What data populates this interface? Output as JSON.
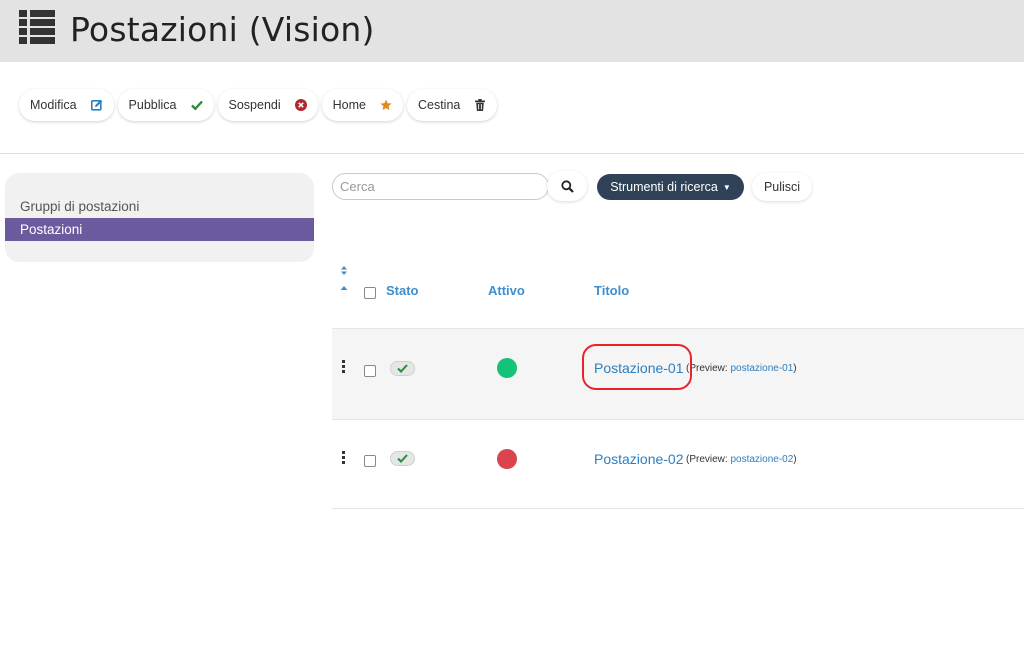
{
  "header": {
    "title": "Postazioni (Vision)",
    "icon": "list-icon"
  },
  "toolbar": {
    "buttons": [
      {
        "label": "Modifica",
        "icon": "edit-icon",
        "color": "#2a7fc1"
      },
      {
        "label": "Pubblica",
        "icon": "check-icon",
        "color": "#2e8b3a"
      },
      {
        "label": "Sospendi",
        "icon": "times-circle-icon",
        "color": "#b0282e"
      },
      {
        "label": "Home",
        "icon": "star-icon",
        "color": "#e08a1e"
      },
      {
        "label": "Cestina",
        "icon": "trash-icon",
        "color": "#333333"
      }
    ]
  },
  "sidebar": {
    "items": [
      {
        "label": "Gruppi di postazioni",
        "active": false
      },
      {
        "label": "Postazioni",
        "active": true
      }
    ]
  },
  "search": {
    "placeholder": "Cerca",
    "value": ""
  },
  "filters": {
    "tools_label": "Strumenti di ricerca",
    "clear_label": "Pulisci"
  },
  "table": {
    "headers": {
      "stato": "Stato",
      "attivo": "Attivo",
      "titolo": "Titolo"
    },
    "rows": [
      {
        "title": "Postazione-01",
        "preview_prefix": "(Preview: ",
        "preview_slug": "postazione-01",
        "preview_suffix": ")",
        "published": true,
        "active_color": "#14c27a"
      },
      {
        "title": "Postazione-02",
        "preview_prefix": "(Preview: ",
        "preview_slug": "postazione-02",
        "preview_suffix": ")",
        "published": true,
        "active_color": "#d9444f"
      }
    ]
  },
  "colors": {
    "accent": "#6b5b9e",
    "link": "#2a7fc1",
    "header_bg": "#e3e3e3",
    "tools_bg": "#2f4258",
    "highlight": "#e8232a"
  }
}
